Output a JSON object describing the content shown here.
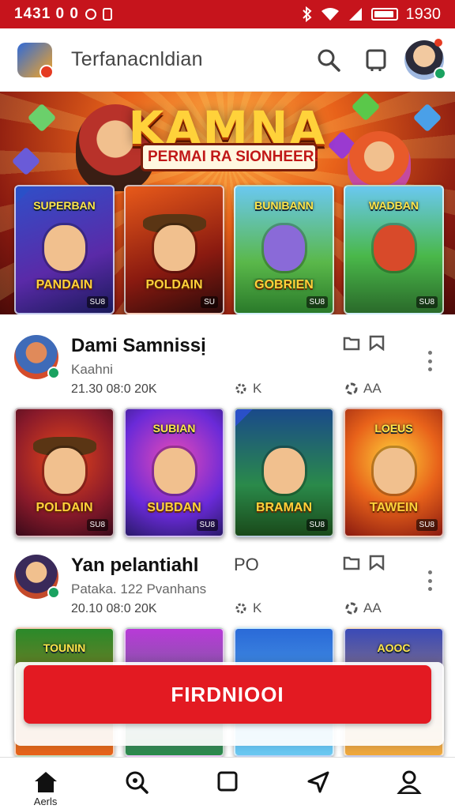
{
  "status_bar": {
    "time_left": "1431 0 0",
    "time_right": "1930"
  },
  "app": {
    "title": "Terfanacnldian"
  },
  "hero": {
    "title": "KAMNA",
    "subtitle": "PERMAI RA SIONHEER!"
  },
  "hero_cards": [
    {
      "top_label": "SUPERBAN",
      "label": "PANDAIN",
      "tag": "SU8"
    },
    {
      "top_label": "",
      "label": "POLDAIN",
      "tag": "SU"
    },
    {
      "top_label": "BUNIBANN",
      "label": "GOBRIEN",
      "tag": "SU8"
    },
    {
      "top_label": "WADBAN",
      "label": "",
      "tag": "SU8"
    }
  ],
  "posts": [
    {
      "title": "Dami Samnissị",
      "tag": "",
      "subtitle": "Kaahni",
      "meta": "21.30 08:0 20K",
      "stat1": "K",
      "stat2": "AA",
      "cards": [
        {
          "top_label": "",
          "label": "POLDAIN",
          "tag": "SU8"
        },
        {
          "top_label": "SUBIAN",
          "label": "SUBDAN",
          "tag": "SU8"
        },
        {
          "top_label": "",
          "label": "BRAMAN",
          "tag": "SU8"
        },
        {
          "top_label": "LOEUS",
          "label": "TAWEIN",
          "tag": "SU8"
        }
      ]
    },
    {
      "title": "Yan pelantiahl",
      "tag": "PO",
      "subtitle": "Pataka. 122 Pvanhans",
      "meta": "20.10 08:0 20K",
      "stat1": "K",
      "stat2": "AA",
      "cards": [
        {
          "top_label": "TOUNIN",
          "label": "",
          "tag": ""
        },
        {
          "top_label": "",
          "label": "",
          "tag": ""
        },
        {
          "top_label": "",
          "label": "",
          "tag": ""
        },
        {
          "top_label": "AOOC",
          "label": "",
          "tag": ""
        }
      ]
    }
  ],
  "cta": {
    "label": "FIRDNIOOI"
  },
  "bottom_nav": [
    {
      "label": "Aerls",
      "icon": "home-icon"
    },
    {
      "label": "",
      "icon": "discover-icon"
    },
    {
      "label": "",
      "icon": "square-icon"
    },
    {
      "label": "",
      "icon": "send-icon"
    },
    {
      "label": "",
      "icon": "profile-icon"
    }
  ],
  "colors": {
    "brand_red": "#c6141c",
    "cta_red": "#e31a22"
  }
}
